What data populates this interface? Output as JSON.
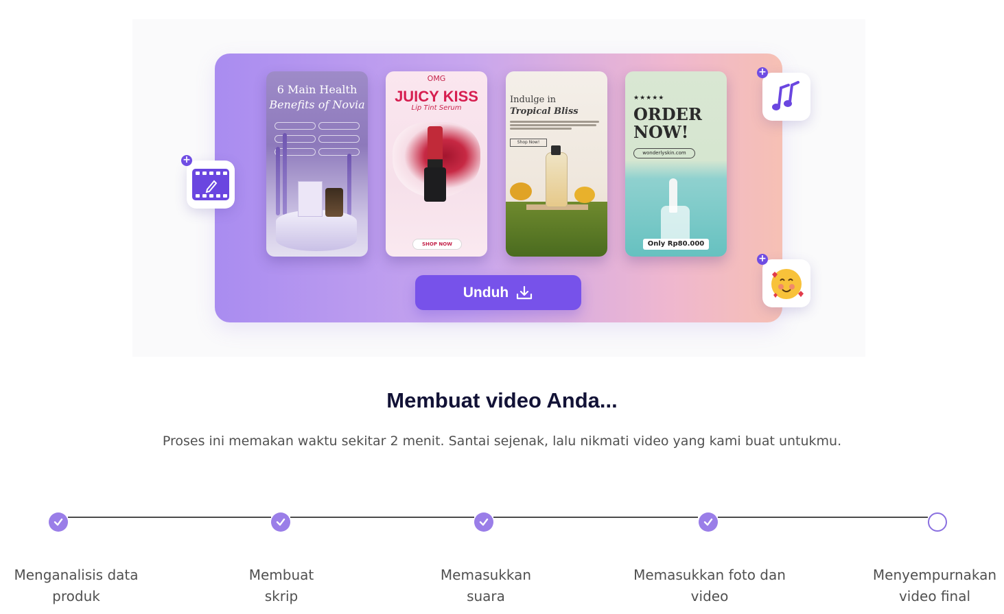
{
  "preview": {
    "card1": {
      "title_line1": "6 Main Health",
      "title_line2": "Benefits of Novia"
    },
    "card2": {
      "brand": "OMG",
      "title": "JUICY KISS",
      "subtitle": "Lip Tint Serum",
      "cta": "SHOP NOW"
    },
    "card3": {
      "title_line1": "Indulge in",
      "title_line2": "Tropical Bliss",
      "cta": "Shop Now!"
    },
    "card4": {
      "stars": "★★★★★",
      "title_line1": "ORDER",
      "title_line2": "NOW!",
      "url": "wonderlyskin.com",
      "price": "Only Rp80.000"
    }
  },
  "download_button": {
    "label": "Unduh",
    "icon": "download-icon"
  },
  "floating_icons": [
    "video-edit-icon",
    "music-notes-icon",
    "smiling-hearts-emoji"
  ],
  "heading": "Membuat video Anda...",
  "subheading": "Proses ini memakan waktu sekitar 2 menit. Santai sejenak, lalu nikmati video yang kami buat untukmu.",
  "steps": [
    {
      "line1": "Menganalisis data",
      "line2": "produk",
      "status": "done"
    },
    {
      "line1": "Membuat",
      "line2": "skrip",
      "status": "done"
    },
    {
      "line1": "Memasukkan",
      "line2": "suara",
      "status": "done"
    },
    {
      "line1": "Memasukkan foto dan",
      "line2": "video",
      "status": "done"
    },
    {
      "line1": "Menyempurnakan",
      "line2": "video final",
      "status": "in-progress"
    }
  ],
  "colors": {
    "accent": "#7752ea",
    "step_done": "#9a7ee8",
    "heading": "#121236"
  }
}
